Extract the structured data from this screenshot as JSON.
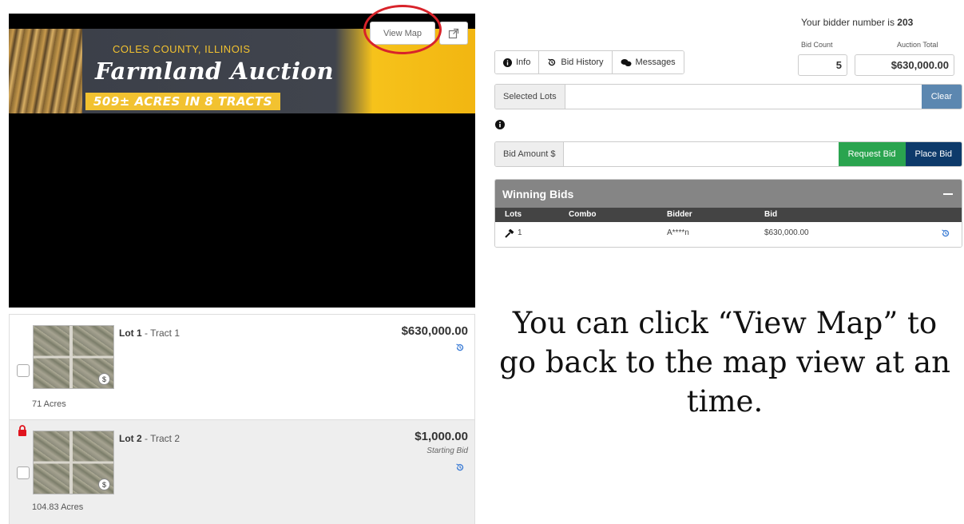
{
  "banner": {
    "county": "COLES COUNTY, ILLINOIS",
    "title": "Farmland Auction",
    "acres": "509± ACRES IN 8 TRACTS",
    "view_map_label": "View Map"
  },
  "lots": [
    {
      "lot": "Lot 1",
      "tract": " - Tract 1",
      "price": "$630,000.00",
      "sub": "",
      "acres": "71 Acres",
      "locked": false
    },
    {
      "lot": "Lot 2",
      "tract": " - Tract 2",
      "price": "$1,000.00",
      "sub": "Starting Bid",
      "acres": "104.83 Acres",
      "locked": true
    }
  ],
  "bidder": {
    "prefix": "Your bidder number is ",
    "number": "203",
    "bid_count_label": "Bid Count",
    "bid_count": "5",
    "auction_total_label": "Auction Total",
    "auction_total": "$630,000.00"
  },
  "tabs": [
    {
      "label": "Info",
      "icon": "info-icon"
    },
    {
      "label": "Bid History",
      "icon": "history-icon"
    },
    {
      "label": "Messages",
      "icon": "messages-icon"
    }
  ],
  "selected_lots": {
    "label": "Selected Lots",
    "value": "",
    "clear_label": "Clear"
  },
  "bid_amount": {
    "label": "Bid Amount $",
    "value": "",
    "request_label": "Request Bid",
    "place_label": "Place Bid"
  },
  "winning_bids": {
    "title": "Winning Bids",
    "columns": [
      "Lots",
      "Combo",
      "Bidder",
      "Bid"
    ],
    "rows": [
      {
        "lot": "1",
        "combo": "",
        "bidder": "A****n",
        "bid": "$630,000.00"
      }
    ]
  },
  "caption": {
    "line1": "You can click “View Map” to",
    "line2": "go back to the map view at an",
    "line3": "time."
  },
  "colors": {
    "annotation_ring": "#d8232a",
    "request_bid": "#2aa44f",
    "place_bid": "#0d3a6a",
    "clear": "#5c87b0",
    "winning_header": "#858585"
  }
}
